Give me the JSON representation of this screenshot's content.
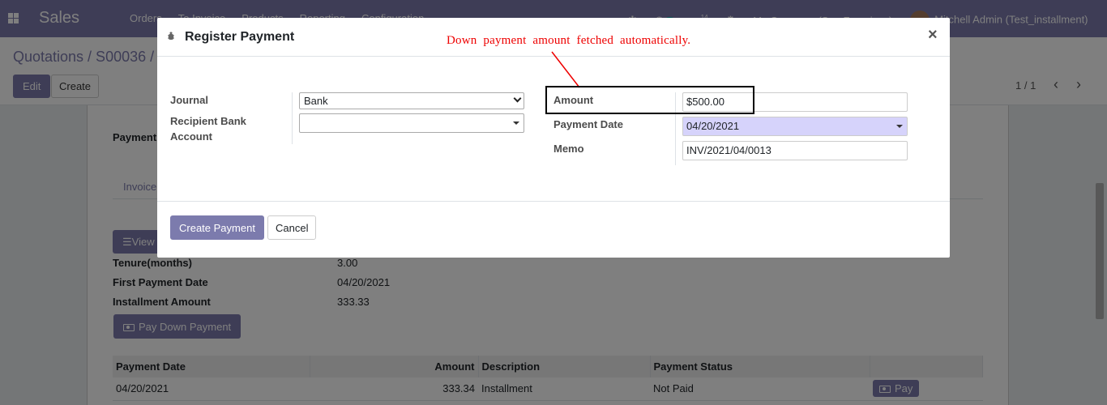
{
  "navbar": {
    "app_name": "Sales",
    "menu": [
      "Orders",
      "To Invoice",
      "Products",
      "Reporting",
      "Configuration"
    ],
    "activity_badge": "2",
    "messages_count": "14",
    "company": "My Company (San Francisco)",
    "user": "Mitchell Admin (Test_installment)"
  },
  "control": {
    "breadcrumb": "Quotations / S00036 /",
    "edit_label": "Edit",
    "create_label": "Create",
    "pager": "1 / 1",
    "pager_prev": "‹",
    "pager_next": "›"
  },
  "form": {
    "payment_label": "Payment",
    "tab_label": "Invoice",
    "view_label": "View",
    "tenure_label": "Tenure(months)",
    "tenure_value": "3.00",
    "first_payment_label": "First Payment Date",
    "first_payment_value": "04/20/2021",
    "installment_label": "Installment Amount",
    "installment_value": "333.33",
    "pay_down_label": "Pay Down Payment",
    "table": {
      "headers": [
        "Payment Date",
        "Amount",
        "Description",
        "Payment Status",
        ""
      ],
      "rows": [
        {
          "date": "04/20/2021",
          "amount": "333.34",
          "description": "Installment",
          "status": "Not Paid",
          "action": "Pay"
        }
      ]
    }
  },
  "modal": {
    "title": "Register Payment",
    "close": "×",
    "annotation": "Down payment amount fetched automatically.",
    "journal_label": "Journal",
    "journal_value": "Bank",
    "recipient_label": "Recipient Bank Account",
    "recipient_value": "",
    "amount_label": "Amount",
    "amount_value": "$500.00",
    "payment_date_label": "Payment Date",
    "payment_date_value": "04/20/2021",
    "memo_label": "Memo",
    "memo_value": "INV/2021/04/0013",
    "create_payment_label": "Create Payment",
    "cancel_label": "Cancel"
  },
  "colors": {
    "brand": "#7c7bad",
    "annotation": "#e00000",
    "date_highlight": "#d6d3fb"
  }
}
